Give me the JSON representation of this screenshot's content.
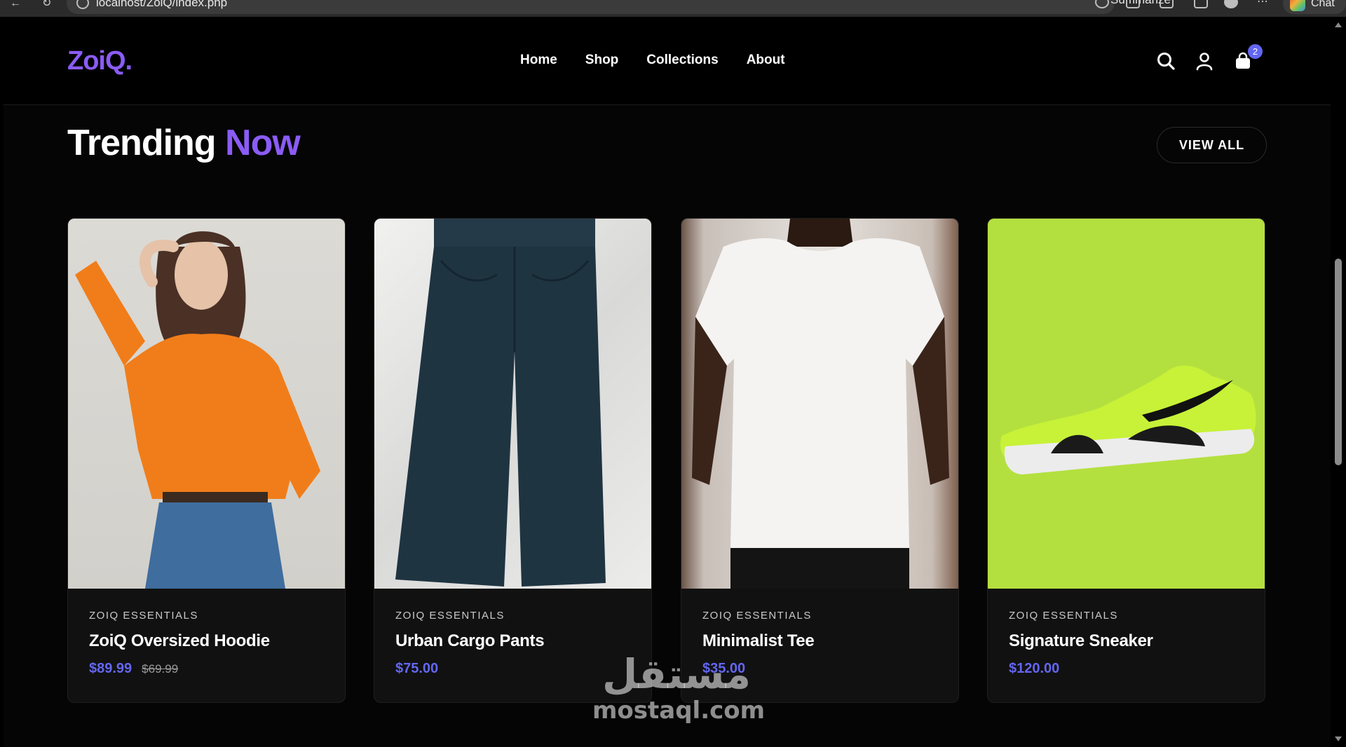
{
  "browser": {
    "url": "localhost/ZoiQ/index.php",
    "summarize_label": "Summarize",
    "chat_label": "Chat"
  },
  "header": {
    "logo": "ZoiQ.",
    "nav": [
      "Home",
      "Shop",
      "Collections",
      "About"
    ],
    "cart_count": "2"
  },
  "section": {
    "title_main": "Trending",
    "title_accent": "Now",
    "view_all_label": "VIEW ALL"
  },
  "products": [
    {
      "brand": "ZOIQ ESSENTIALS",
      "name": "ZoiQ Oversized Hoodie",
      "price": "$89.99",
      "old_price": "$69.99"
    },
    {
      "brand": "ZOIQ ESSENTIALS",
      "name": "Urban Cargo Pants",
      "price": "$75.00"
    },
    {
      "brand": "ZOIQ ESSENTIALS",
      "name": "Minimalist Tee",
      "price": "$35.00"
    },
    {
      "brand": "ZOIQ ESSENTIALS",
      "name": "Signature Sneaker",
      "price": "$120.00"
    }
  ],
  "watermark": {
    "arabic": "مستقل",
    "latin": "mostaql.com"
  },
  "colors": {
    "accent_purple": "#8b5cf6",
    "price_blue": "#6366f1",
    "background": "#050505",
    "card": "#111111",
    "sneaker_bg": "#b4e03f"
  },
  "icons": [
    "back-icon",
    "reload-icon",
    "info-icon",
    "star-icon",
    "extensions-icon",
    "favorites-icon",
    "downloads-icon",
    "profile-icon",
    "more-icon",
    "search-icon",
    "user-icon",
    "cart-icon"
  ]
}
